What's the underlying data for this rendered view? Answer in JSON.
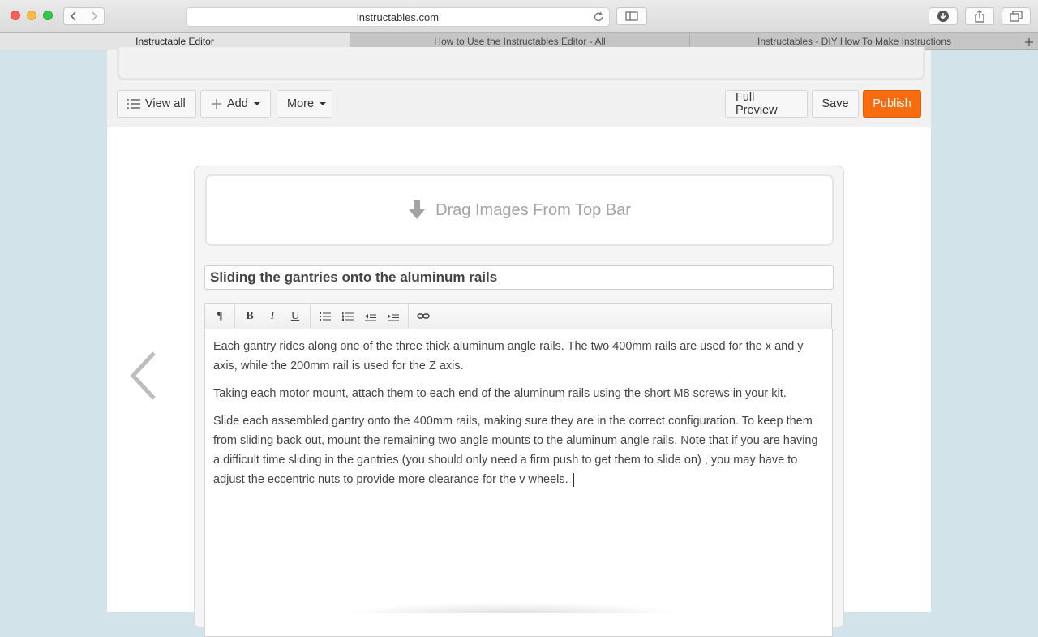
{
  "browser": {
    "url": "instructables.com",
    "tabs": [
      {
        "label": "Instructable Editor",
        "active": true
      },
      {
        "label": "How to Use the Instructables Editor - All",
        "active": false
      },
      {
        "label": "Instructables - DIY How To Make Instructions",
        "active": false
      }
    ]
  },
  "toolbar": {
    "view_all_label": "View all",
    "add_label": "Add",
    "more_label": "More",
    "full_preview_label": "Full Preview",
    "save_label": "Save",
    "publish_label": "Publish"
  },
  "step": {
    "dropzone_text": "Drag Images From Top Bar",
    "title": "Sliding the gantries onto the aluminum rails",
    "paragraphs": [
      "Each gantry rides along one of the three thick aluminum angle rails. The two 400mm rails are used for the x and y axis, while the 200mm rail is used for the Z axis.",
      "Taking each motor mount, attach them to each end of the aluminum rails using the short M8 screws in your kit.",
      "Slide each assembled gantry onto the 400mm rails, making sure they are in the correct configuration. To keep them from sliding back out, mount the remaining two angle mounts to the aluminum angle rails. Note that if you are having a difficult time sliding in the gantries (you should only need a firm push to get them to slide on) , you may have to adjust the eccentric nuts to provide more clearance for the v wheels."
    ]
  },
  "editor_toolbar": {
    "paragraph_glyph": "¶",
    "bold_glyph": "B",
    "italic_glyph": "I",
    "underline_glyph": "U"
  },
  "colors": {
    "publish": "#f86b0e",
    "page_background": "#d3e3ea"
  }
}
